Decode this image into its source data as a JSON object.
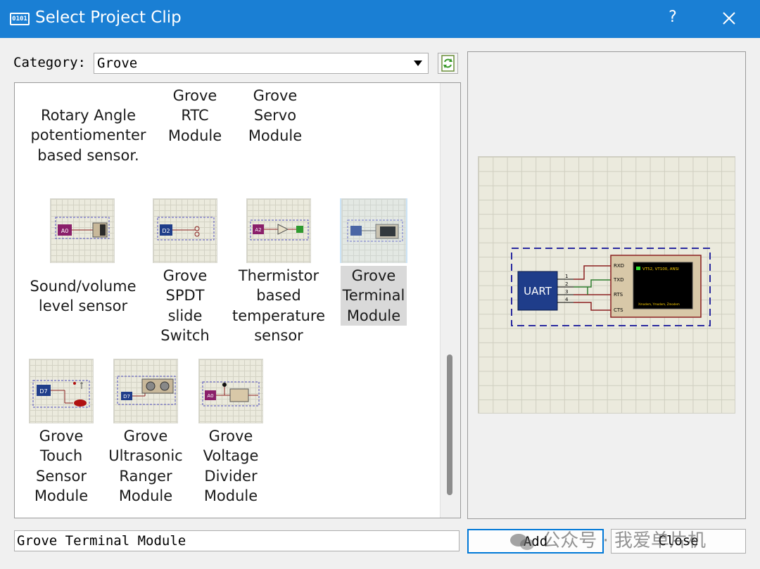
{
  "window": {
    "title": "Select Project Clip",
    "icon_text": "0101",
    "help_label": "?"
  },
  "category": {
    "label": "Category:",
    "value": "Grove"
  },
  "clips": [
    {
      "label": "Rotary Angle\npotentiomenter\nbased sensor.",
      "icon": "none",
      "selected": false
    },
    {
      "label": "Grove\nRTC\nModule",
      "icon": "none",
      "selected": false
    },
    {
      "label": "Grove\nServo\nModule",
      "icon": "none",
      "selected": false
    },
    {
      "label": "Sound/volume\nlevel sensor",
      "icon": "grove-sound-thumbnail",
      "chip": "A0",
      "selected": false
    },
    {
      "label": "Grove\nSPDT\nslide\nSwitch",
      "icon": "grove-spdt-thumbnail",
      "chip": "D2",
      "selected": false
    },
    {
      "label": "Thermistor\nbased\ntemperature\nsensor",
      "icon": "grove-thermistor-thumbnail",
      "chip": "A2",
      "selected": false
    },
    {
      "label": "Grove\nTerminal\nModule",
      "icon": "grove-terminal-thumbnail",
      "chip": "",
      "selected": true
    },
    {
      "label": "Grove\nTouch\nSensor\nModule",
      "icon": "grove-touch-thumbnail",
      "chip": "D7",
      "selected": false
    },
    {
      "label": "Grove\nUltrasonic\nRanger\nModule",
      "icon": "grove-ultrasonic-thumbnail",
      "chip": "D7",
      "selected": false
    },
    {
      "label": "Grove\nVoltage\nDivider\nModule",
      "icon": "grove-voltage-divider-thumbnail",
      "chip": "A0",
      "selected": false
    }
  ],
  "preview": {
    "uart_label": "UART",
    "pins": [
      "1",
      "2",
      "3",
      "4"
    ],
    "terminal_pins": [
      "RXD",
      "TXD",
      "RTS",
      "CTS"
    ],
    "terminal_title": "VT52, VT100, ANSI",
    "terminal_footer": "Xmodem, Ymodem, Zmodem"
  },
  "selected_name": "Grove Terminal Module",
  "buttons": {
    "add": "Add",
    "close": "Close"
  },
  "watermark": "公众号 · 我爱单片机",
  "colors": {
    "titlebar": "#1a7fd4",
    "selection": "#cce4f7",
    "uart_block": "#1f3d8a",
    "terminal_screen": "#000000"
  }
}
